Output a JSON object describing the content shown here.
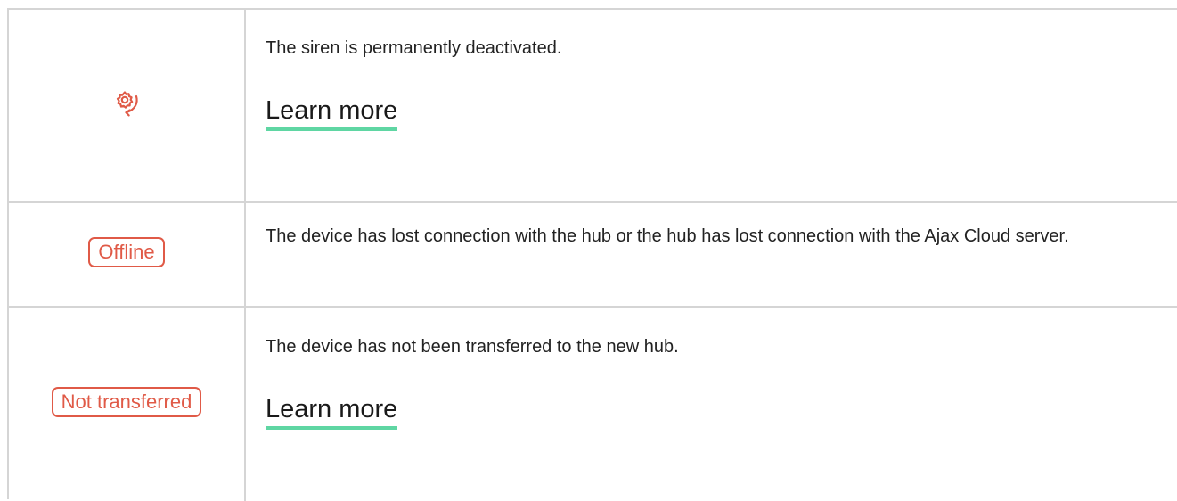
{
  "rows": [
    {
      "status_icon": "siren-deactivated-icon",
      "description": "The siren is permanently deactivated.",
      "link_label": "Learn more"
    },
    {
      "status_badge": "Offline",
      "description": "The device has lost connection with the hub or the hub has lost connection with the Ajax Cloud server."
    },
    {
      "status_badge": "Not transferred",
      "description": "The device has not been transferred to the new hub.",
      "link_label": "Learn more"
    }
  ],
  "colors": {
    "status_red": "#e05a47",
    "link_underline": "#5fd6a3",
    "border": "#d5d5d5"
  }
}
